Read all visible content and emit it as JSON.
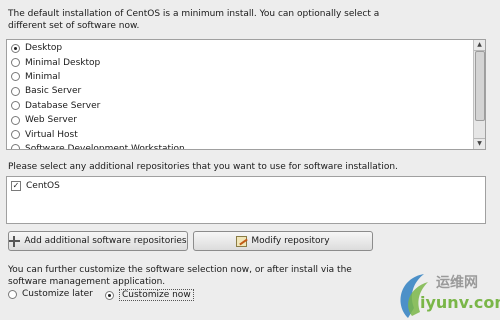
{
  "intro_text": "The default installation of CentOS is a minimum install. You can optionally select a different set of software now.",
  "software_sets": [
    {
      "label": "Desktop",
      "selected": true
    },
    {
      "label": "Minimal Desktop",
      "selected": false
    },
    {
      "label": "Minimal",
      "selected": false
    },
    {
      "label": "Basic Server",
      "selected": false
    },
    {
      "label": "Database Server",
      "selected": false
    },
    {
      "label": "Web Server",
      "selected": false
    },
    {
      "label": "Virtual Host",
      "selected": false
    },
    {
      "label": "Software Development Workstation",
      "selected": false
    }
  ],
  "repo_prompt": "Please select any additional repositories that you want to use for software installation.",
  "repositories": [
    {
      "label": "CentOS",
      "checked": true
    }
  ],
  "buttons": {
    "add_repo": "Add additional software repositories",
    "modify_repo": "Modify repository"
  },
  "customize_text": "You can further customize the software selection now, or after install via the software management application.",
  "customize_options": {
    "later": "Customize later",
    "now": "Customize now",
    "selected": "now"
  },
  "watermark": {
    "chinese": "运维网",
    "domain": "iyunv.com"
  },
  "colors": {
    "watermark_green": "#7ab648",
    "watermark_blue": "#2f7fc1"
  }
}
